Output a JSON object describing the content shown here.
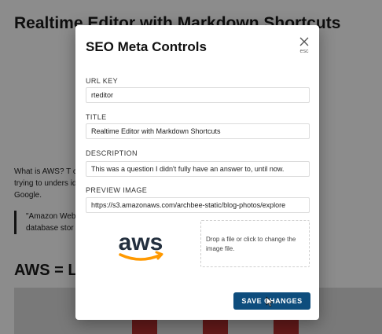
{
  "article": {
    "title": "Realtime Editor with Markdown Shortcuts",
    "para_line1": "What is AWS? T                                                                  ck when I was fi",
    "para_line2": "trying to unders                                                                id, I searched on",
    "para_line3": "Google.",
    "quote_line1": "\"Amazon Web                                                           ompute power,",
    "quote_line2": "database stor                                                          s scale and grow.",
    "heading2": "AWS = L"
  },
  "modal": {
    "title": "SEO Meta Controls",
    "close_hint": "esc",
    "url_key": {
      "label": "URL KEY",
      "value": "rteditor"
    },
    "title_field": {
      "label": "TITLE",
      "value": "Realtime Editor with Markdown Shortcuts"
    },
    "description": {
      "label": "DESCRIPTION",
      "value": "This was a question I didn't fully have an answer to, until now."
    },
    "preview_image": {
      "label": "PREVIEW IMAGE",
      "value": "https://s3.amazonaws.com/archbee-static/blog-photos/explore"
    },
    "aws_logo_text": "aws",
    "dropzone_text": "Drop a file or click to change the image file.",
    "save_label": "SAVE CHANGES"
  },
  "colors": {
    "save_button": "#0e4d7d",
    "aws_text": "#232f3e",
    "aws_smile": "#ff9900"
  },
  "icons": {
    "close": "close-icon",
    "cursor": "pointer-cursor-icon"
  }
}
